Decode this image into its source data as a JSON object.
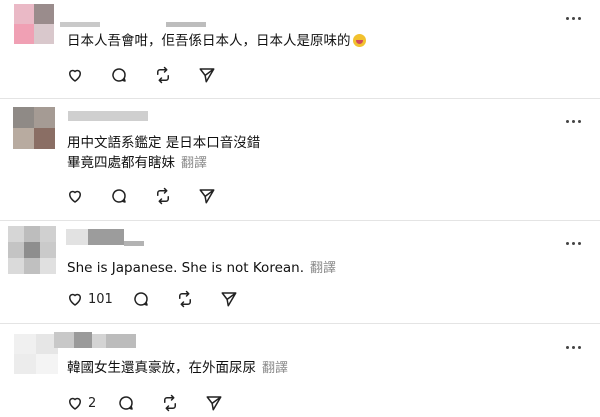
{
  "comments": [
    {
      "text_lines": [
        "日本人吾會咁，佢吾係日本人，日本人是原味的"
      ],
      "translate": "",
      "has_emoji": true,
      "like_count": ""
    },
    {
      "text_lines": [
        "用中文語系鑑定 是日本口音沒錯",
        "畢竟四處都有瞎妹"
      ],
      "translate": "翻譯",
      "has_emoji": false,
      "like_count": ""
    },
    {
      "text_lines": [
        "She is Japanese. She is not Korean."
      ],
      "translate": "翻譯",
      "has_emoji": false,
      "like_count": "101"
    },
    {
      "text_lines": [
        "韓國女生還真豪放，在外面尿尿"
      ],
      "translate": "翻譯",
      "has_emoji": false,
      "like_count": "2"
    }
  ],
  "icons": {
    "like": "heart-icon",
    "reply": "comment-icon",
    "repost": "repost-icon",
    "share": "send-icon",
    "more": "more-icon",
    "emoji": "emoji-icon"
  },
  "colors": {
    "text": "#111111",
    "muted": "#8a8a8a",
    "divider": "#e4e4e4",
    "icon": "#222222"
  }
}
